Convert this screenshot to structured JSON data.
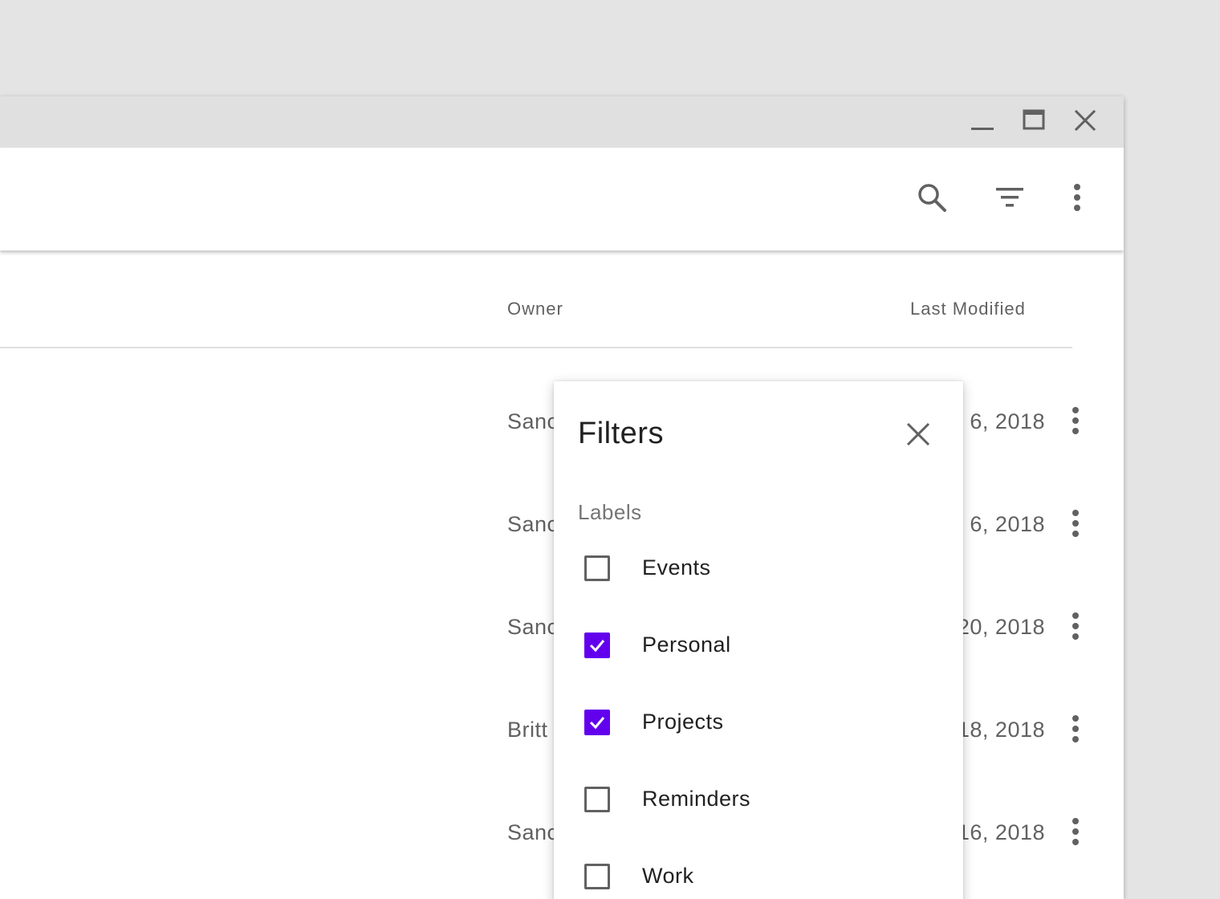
{
  "window_controls": {
    "minimize_icon": "minimize-icon",
    "maximize_icon": "maximize-icon",
    "close_icon": "close-icon"
  },
  "toolbar": {
    "icons": [
      "search-icon",
      "filter-list-icon",
      "more-vert-icon"
    ]
  },
  "table": {
    "columns": {
      "owner": "Owner",
      "last_modified": "Last Modified"
    },
    "rows": [
      {
        "owner": "Sanc",
        "date": "6, 2018"
      },
      {
        "owner": "Sanc",
        "date": "6, 2018"
      },
      {
        "owner": "Sanc",
        "date": "20, 2018"
      },
      {
        "owner": "Britt",
        "date": "18, 2018"
      },
      {
        "owner": "Sanc",
        "date": "16, 2018"
      }
    ]
  },
  "filters": {
    "title": "Filters",
    "section": "Labels",
    "options": [
      {
        "label": "Events",
        "checked": false
      },
      {
        "label": "Personal",
        "checked": true
      },
      {
        "label": "Projects",
        "checked": true
      },
      {
        "label": "Reminders",
        "checked": false
      },
      {
        "label": "Work",
        "checked": false
      }
    ]
  },
  "colors": {
    "accent": "#6200ee",
    "icon": "#616161",
    "titlebar": "#e0e0e0",
    "background": "#e4e4e4"
  }
}
